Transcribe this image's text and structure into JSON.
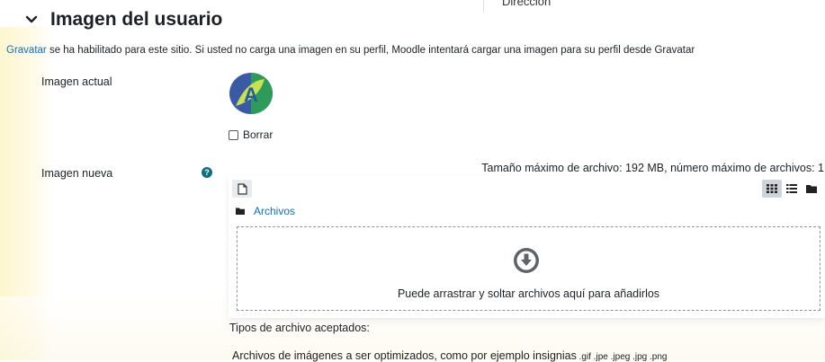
{
  "section": {
    "title": "Imagen del usuario",
    "top_cut_text": "Dirección"
  },
  "notice": {
    "link_text": "Gravatar",
    "text": " se ha habilitado para este sitio. Si usted no carga una imagen en su perfil, Moodle intentará cargar una imagen para su perfil desde Gravatar"
  },
  "current_image": {
    "label": "Imagen actual",
    "delete_label": "Borrar"
  },
  "new_image": {
    "label": "Imagen nueva",
    "max_size_text": "Tamaño máximo de archivo: 192 MB, número máximo de archivos: 1",
    "path_link": "Archivos",
    "drop_text": "Puede arrastrar y soltar archivos aquí para añadirlos",
    "accepted_label": "Tipos de archivo aceptados:",
    "accepted_text": "Archivos de imágenes a ser optimizados, como por ejemplo insignias",
    "accepted_ext": " .gif .jpe .jpeg .jpg .png"
  },
  "colors": {
    "link": "#0f6cbf",
    "help_icon": "#0f6f7f",
    "avatar_blue": "#3b5aa6",
    "avatar_green": "#2e9b5a",
    "avatar_lime": "#c9e052"
  },
  "icons": {
    "collapse": "chevron-down-icon",
    "help": "question-circle-icon",
    "add_file": "file-icon",
    "view_icons": "grid-icon",
    "view_list": "list-icon",
    "view_tree": "folder-icon",
    "drop": "download-circle-icon"
  }
}
